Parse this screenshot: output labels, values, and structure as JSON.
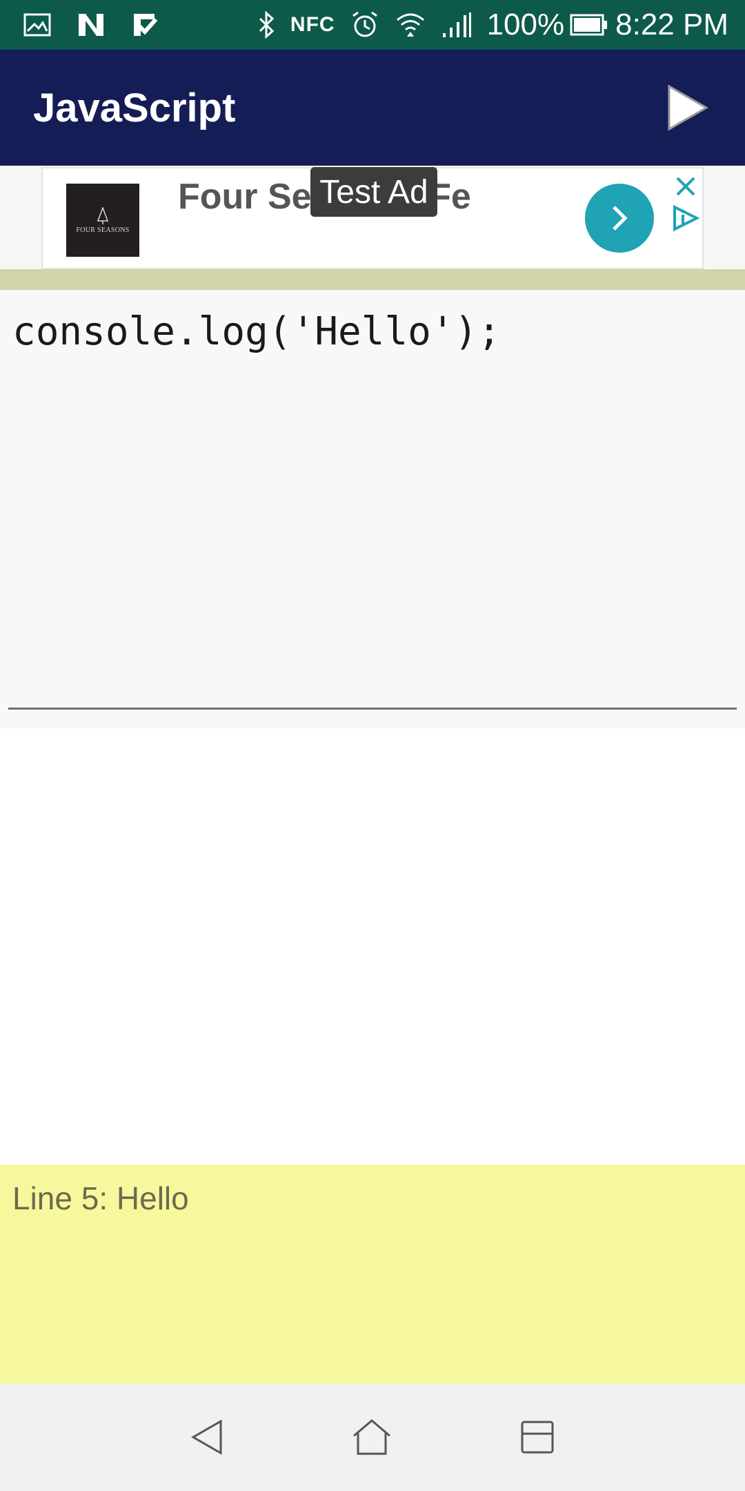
{
  "status_bar": {
    "battery_percent": "100%",
    "time": "8:22 PM",
    "nfc_label": "NFC",
    "icons": [
      "gallery-icon",
      "n-app-icon",
      "check-app-icon",
      "bluetooth-icon",
      "nfc-icon",
      "alarm-icon",
      "wifi-icon",
      "signal-icon",
      "battery-icon"
    ]
  },
  "app_bar": {
    "title": "JavaScript",
    "run_icon": "play-icon"
  },
  "ad": {
    "headline": "Four Se  Santa Fe",
    "badge": "Test Ad",
    "logo_caption": "FOUR SEASONS",
    "button_icon": "chevron-right-icon",
    "close_icon": "close-icon",
    "choices_icon": "ad-choices-icon",
    "accent_color": "#1fa3b5"
  },
  "editor": {
    "code": "console.log('Hello');"
  },
  "console": {
    "output": "Line 5: Hello",
    "background": "#f7f79e"
  },
  "nav_bar": {
    "icons": [
      "back-icon",
      "home-icon",
      "recents-icon"
    ]
  },
  "colors": {
    "status_bar": "#0d5a4a",
    "app_bar": "#151d56"
  }
}
